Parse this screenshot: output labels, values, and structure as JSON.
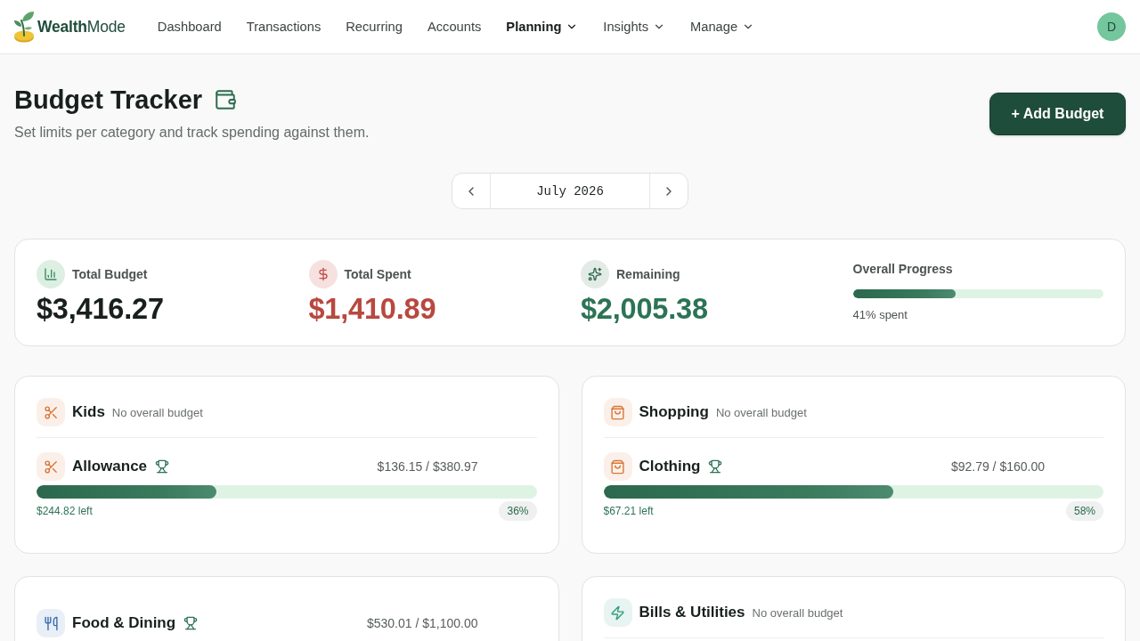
{
  "brand": {
    "name": "**Wealth**Mode"
  },
  "nav": [
    {
      "label": "Dashboard",
      "selected": false,
      "dropdown": false
    },
    {
      "label": "Transactions",
      "selected": false,
      "dropdown": false
    },
    {
      "label": "Recurring",
      "selected": false,
      "dropdown": false
    },
    {
      "label": "Accounts",
      "selected": false,
      "dropdown": false
    },
    {
      "label": "Planning",
      "selected": true,
      "dropdown": true
    },
    {
      "label": "Insights",
      "selected": false,
      "dropdown": true
    },
    {
      "label": "Manage",
      "selected": false,
      "dropdown": true
    }
  ],
  "user": {
    "initial": "D"
  },
  "page": {
    "title": "Budget Tracker",
    "subtitle": "Set limits per category and track spending against them.",
    "add_button": "+ Add Budget"
  },
  "month": {
    "label": "July 2026"
  },
  "summary": {
    "stats": [
      {
        "kind": "budget",
        "label": "Total Budget",
        "value": "$3,416.27"
      },
      {
        "kind": "spent",
        "label": "Total Spent",
        "value": "$1,410.89"
      },
      {
        "kind": "remaining",
        "label": "Remaining",
        "value": "$2,005.38"
      }
    ],
    "progress": {
      "label": "Overall Progress",
      "level": 0.41,
      "caption": "41% spent"
    }
  },
  "cards": [
    {
      "header": {
        "name": "Kids",
        "note": "No overall budget",
        "kind": "kids",
        "color": "#d9773a"
      },
      "items": [
        {
          "name": "Allowance",
          "kind": "kids",
          "color": "#d9773a",
          "amount": "$136.15 / $380.97",
          "level": 0.36,
          "left": "$244.82 left",
          "percent": "36%"
        }
      ]
    },
    {
      "header": {
        "name": "Shopping",
        "note": "No overall budget",
        "kind": "shopping",
        "color": "#d9773a"
      },
      "items": [
        {
          "name": "Clothing",
          "kind": "shopping",
          "color": "#d9773a",
          "amount": "$92.79 / $160.00",
          "level": 0.58,
          "left": "$67.21 left",
          "percent": "58%"
        }
      ]
    },
    {
      "items": [
        {
          "name": "Food & Dining",
          "kind": "dining",
          "color": "#3b6fb0",
          "amount": "$530.01 / $1,100.00"
        }
      ]
    },
    {
      "header": {
        "name": "Bills & Utilities",
        "note": "No overall budget",
        "kind": "utilities",
        "color": "#2f9e7c"
      }
    }
  ]
}
